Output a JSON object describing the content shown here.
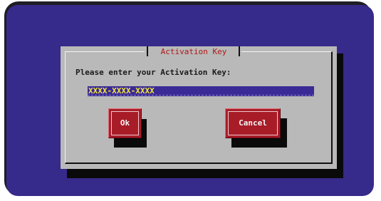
{
  "dialog": {
    "title": "Activation Key",
    "prompt": "Please enter your Activation Key:",
    "activation_key_value": "XXXX-XXXX-XXXX",
    "buttons": {
      "ok_label": "Ok",
      "cancel_label": "Cancel"
    }
  },
  "colors": {
    "background": "#362a8a",
    "dialog_body": "#b9b9b9",
    "title_text": "#b01818",
    "entry_background": "#3a2a96",
    "entry_text": "#f2e63a",
    "button": "#a81c28",
    "button_text": "#f4f4f4"
  }
}
